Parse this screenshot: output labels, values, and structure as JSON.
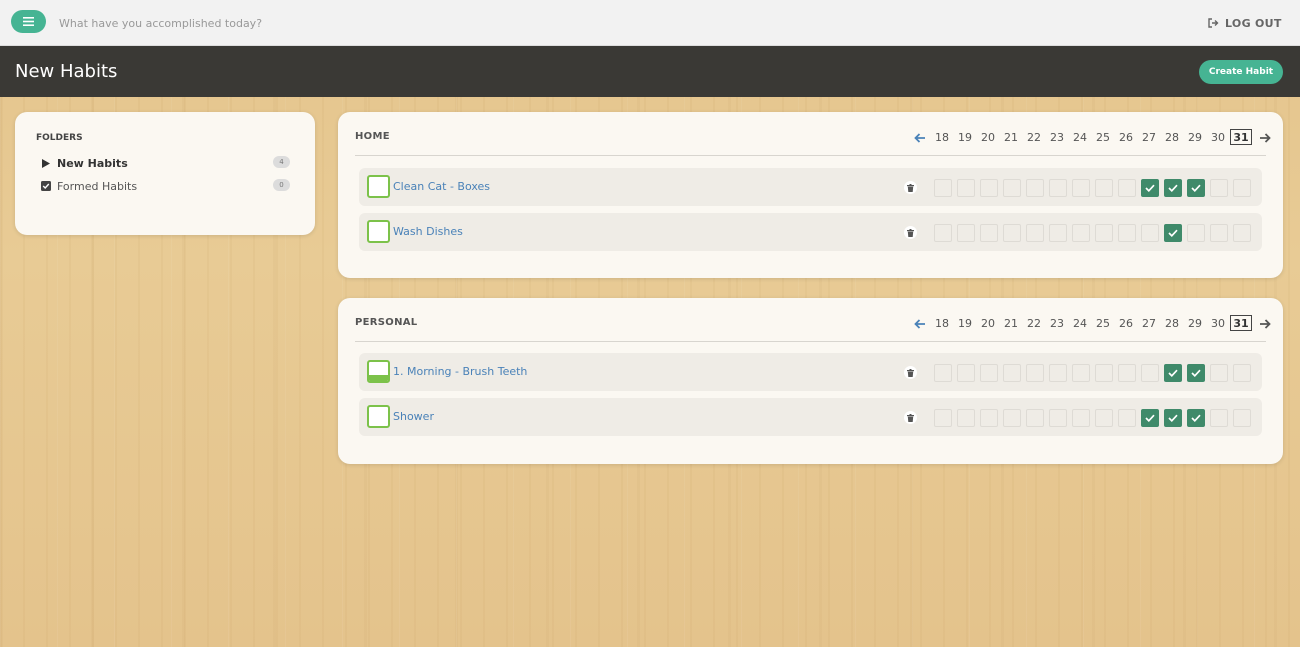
{
  "topbar": {
    "input_placeholder": "What have you accomplished today?",
    "logout_label": "LOG OUT"
  },
  "titlebar": {
    "title": "New Habits",
    "create_label": "Create Habit"
  },
  "colors": {
    "accent": "#46b493",
    "done": "#3f8a6a",
    "habit_green": "#7cc24a",
    "link": "#4a82b8",
    "titlebar_bg": "#3a3935"
  },
  "folders": {
    "title": "FOLDERS",
    "items": [
      {
        "label": "New Habits",
        "count": "4",
        "icon": "caret-right-icon",
        "active": true
      },
      {
        "label": "Formed Habits",
        "count": "0",
        "icon": "checkbox-checked-icon",
        "active": false
      }
    ]
  },
  "days": [
    "18",
    "19",
    "20",
    "21",
    "22",
    "23",
    "24",
    "25",
    "26",
    "27",
    "28",
    "29",
    "30",
    "31"
  ],
  "today": "31",
  "groups": [
    {
      "name": "HOME",
      "habits": [
        {
          "name": "Clean Cat - Boxes",
          "progress": 0,
          "done": [
            false,
            false,
            false,
            false,
            false,
            false,
            false,
            false,
            false,
            true,
            true,
            true,
            false,
            false
          ]
        },
        {
          "name": "Wash Dishes",
          "progress": 0,
          "done": [
            false,
            false,
            false,
            false,
            false,
            false,
            false,
            false,
            false,
            false,
            true,
            false,
            false,
            false
          ]
        }
      ]
    },
    {
      "name": "PERSONAL",
      "habits": [
        {
          "name": "1. Morning - Brush Teeth",
          "progress": 0.3,
          "done": [
            false,
            false,
            false,
            false,
            false,
            false,
            false,
            false,
            false,
            false,
            true,
            true,
            false,
            false
          ]
        },
        {
          "name": "Shower",
          "progress": 0,
          "done": [
            false,
            false,
            false,
            false,
            false,
            false,
            false,
            false,
            false,
            true,
            true,
            true,
            false,
            false
          ]
        }
      ]
    }
  ]
}
